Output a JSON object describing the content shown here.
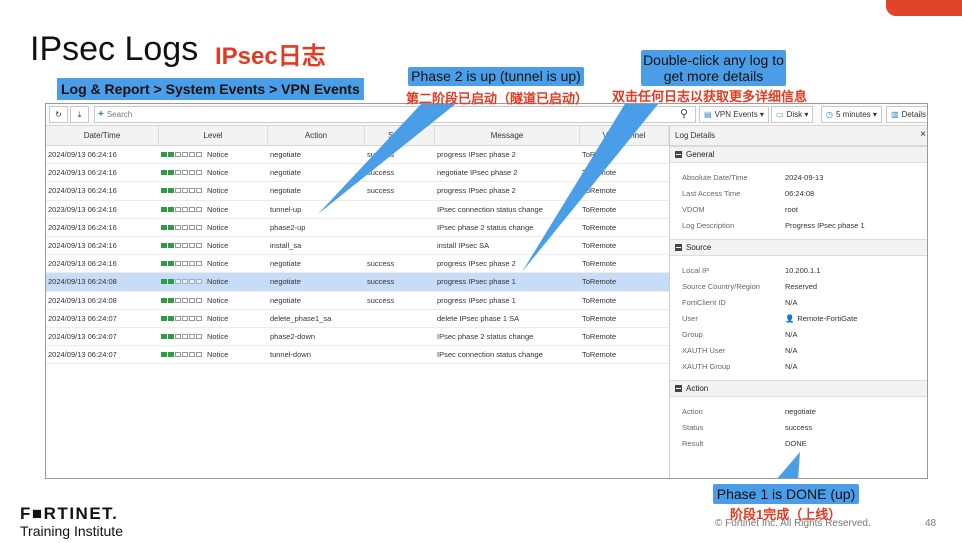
{
  "slide": {
    "title": "IPsec Logs",
    "title_cn": "IPsec日志",
    "breadcrumb": "Log & Report > System Events > VPN Events",
    "logo": "F■RTINET.",
    "logo_sub": "Training Institute",
    "copyright": "© Fortinet Inc. All Rights Reserved.",
    "page_number": "48"
  },
  "toolbar": {
    "refresh_icon": "↻",
    "download_icon": "⤓",
    "search_placeholder": "Search",
    "search_plus": "+",
    "search_icon": "⚲",
    "vpn_events": "VPN Events ▾",
    "disk": "Disk ▾",
    "time_range": "5 minutes ▾",
    "details": "Details"
  },
  "table": {
    "headers": [
      "Date/Time",
      "Level",
      "Action",
      "Status",
      "Message",
      "VPN Tunnel"
    ],
    "rows": [
      {
        "date": "2024/09/13 06:24:16",
        "level": "Notice",
        "action": "negotiate",
        "status": "success",
        "message": "progress IPsec phase 2",
        "vpn": "ToRemote"
      },
      {
        "date": "2024/09/13 06:24:16",
        "level": "Notice",
        "action": "negotiate",
        "status": "success",
        "message": "negotiate IPsec phase 2",
        "vpn": "ToRemote"
      },
      {
        "date": "2024/09/13 06:24:16",
        "level": "Notice",
        "action": "negotiate",
        "status": "success",
        "message": "progress IPsec phase 2",
        "vpn": "ToRemote"
      },
      {
        "date": "2023/09/13 06:24:16",
        "level": "Notice",
        "action": "tunnel-up",
        "status": "",
        "message": "IPsec connection status change",
        "vpn": "ToRemote"
      },
      {
        "date": "2024/09/13 06:24:16",
        "level": "Notice",
        "action": "phase2-up",
        "status": "",
        "message": "IPsec phase 2 status change",
        "vpn": "ToRemote"
      },
      {
        "date": "2024/09/13 06:24:16",
        "level": "Notice",
        "action": "install_sa",
        "status": "",
        "message": "install IPsec SA",
        "vpn": "ToRemote"
      },
      {
        "date": "2024/09/13 06:24:16",
        "level": "Notice",
        "action": "negotiate",
        "status": "success",
        "message": "progress IPsec phase 2",
        "vpn": "ToRemote"
      },
      {
        "date": "2024/09/13 06:24:08",
        "level": "Notice",
        "action": "negotiate",
        "status": "success",
        "message": "progress IPsec phase 1",
        "vpn": "ToRemote"
      },
      {
        "date": "2024/09/13 06:24:08",
        "level": "Notice",
        "action": "negotiate",
        "status": "success",
        "message": "progress IPsec phase 1",
        "vpn": "ToRemote"
      },
      {
        "date": "2024/09/13 06:24:07",
        "level": "Notice",
        "action": "delete_phase1_sa",
        "status": "",
        "message": "delete IPsec phase 1 SA",
        "vpn": "ToRemote"
      },
      {
        "date": "2024/09/13 06:24:07",
        "level": "Notice",
        "action": "phase2-down",
        "status": "",
        "message": "IPsec phase 2 status change",
        "vpn": "ToRemote"
      },
      {
        "date": "2024/09/13 06:24:07",
        "level": "Notice",
        "action": "tunnel-down",
        "status": "",
        "message": "IPsec connection status change",
        "vpn": "ToRemote"
      }
    ],
    "selected_row": 7
  },
  "details": {
    "title": "Log Details",
    "close": "×",
    "general_label": "General",
    "general": [
      {
        "k": "Absolute Date/Time",
        "v": "2024-09-13"
      },
      {
        "k": "Last Access Time",
        "v": "06:24:08"
      },
      {
        "k": "VDOM",
        "v": "root"
      },
      {
        "k": "Log Description",
        "v": "Progress IPsec phase 1"
      }
    ],
    "source_label": "Source",
    "source": [
      {
        "k": "Local IP",
        "v": "10.200.1.1"
      },
      {
        "k": "Source Country/Region",
        "v": "Reserved"
      },
      {
        "k": "FortiClient ID",
        "v": "N/A"
      },
      {
        "k": "User",
        "v": "Remote-FortiGate"
      },
      {
        "k": "Group",
        "v": "N/A"
      },
      {
        "k": "XAUTH User",
        "v": "N/A"
      },
      {
        "k": "XAUTH Group",
        "v": "N/A"
      }
    ],
    "action_label": "Action",
    "action": [
      {
        "k": "Action",
        "v": "negotiate"
      },
      {
        "k": "Status",
        "v": "success"
      },
      {
        "k": "Result",
        "v": "DONE"
      }
    ]
  },
  "callouts": {
    "phase2": "Phase 2 is up (tunnel is up)",
    "phase2_cn": "第二阶段已启动（隧道已启动）",
    "dblclick": "Double-click any log to get more details",
    "dblclick_cn": "双击任何日志以获取更多详细信息",
    "phase1": "Phase 1 is DONE (up)",
    "phase1_cn": "阶段1完成（上线）"
  },
  "colors": {
    "accent_red": "#e23b23",
    "callout_blue": "#4a9ee8",
    "level_green": "#2e9b47",
    "selected_row": "#c7dcf7"
  }
}
